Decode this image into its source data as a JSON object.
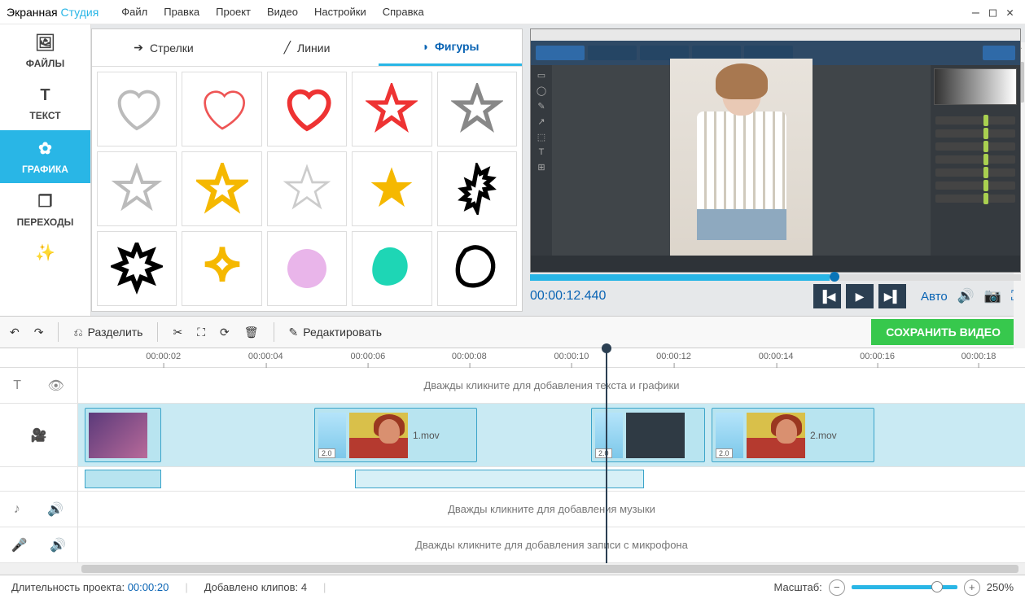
{
  "app": {
    "title1": "Экранная",
    "title2": "Студия"
  },
  "menu": [
    "Файл",
    "Правка",
    "Проект",
    "Видео",
    "Настройки",
    "Справка"
  ],
  "vtabs": [
    {
      "id": "files",
      "label": "ФАЙЛЫ",
      "icon": "🖼"
    },
    {
      "id": "text",
      "label": "ТЕКСТ",
      "icon": "T"
    },
    {
      "id": "graphics",
      "label": "ГРАФИКА",
      "icon": "✿"
    },
    {
      "id": "transitions",
      "label": "ПЕРЕХОДЫ",
      "icon": "❐"
    },
    {
      "id": "effects",
      "label": "",
      "icon": "✨"
    }
  ],
  "gtabs": {
    "arrows": "Стрелки",
    "lines": "Линии",
    "shapes": "Фигуры"
  },
  "preview": {
    "time": "00:00:12.440",
    "auto": "Авто"
  },
  "toolbar": {
    "split": "Разделить",
    "edit": "Редактировать",
    "save": "СОХРАНИТЬ ВИДЕО"
  },
  "ruler": [
    "00:00:02",
    "00:00:04",
    "00:00:06",
    "00:00:08",
    "00:00:10",
    "00:00:12",
    "00:00:14",
    "00:00:16",
    "00:00:18"
  ],
  "tracks": {
    "text_hint": "Дважды кликните для добавления текста и графики",
    "music_hint": "Дважды кликните для добавления музыки",
    "mic_hint": "Дважды кликните для добавления записи с микрофона"
  },
  "clips": {
    "c1_label": "1.mov",
    "c2_label": "2.mov",
    "speed": "2.0"
  },
  "status": {
    "duration_label": "Длительность проекта:",
    "duration_value": "00:00:20",
    "clips_label": "Добавлено клипов:",
    "clips_value": "4",
    "zoom_label": "Масштаб:",
    "zoom_value": "250%"
  }
}
